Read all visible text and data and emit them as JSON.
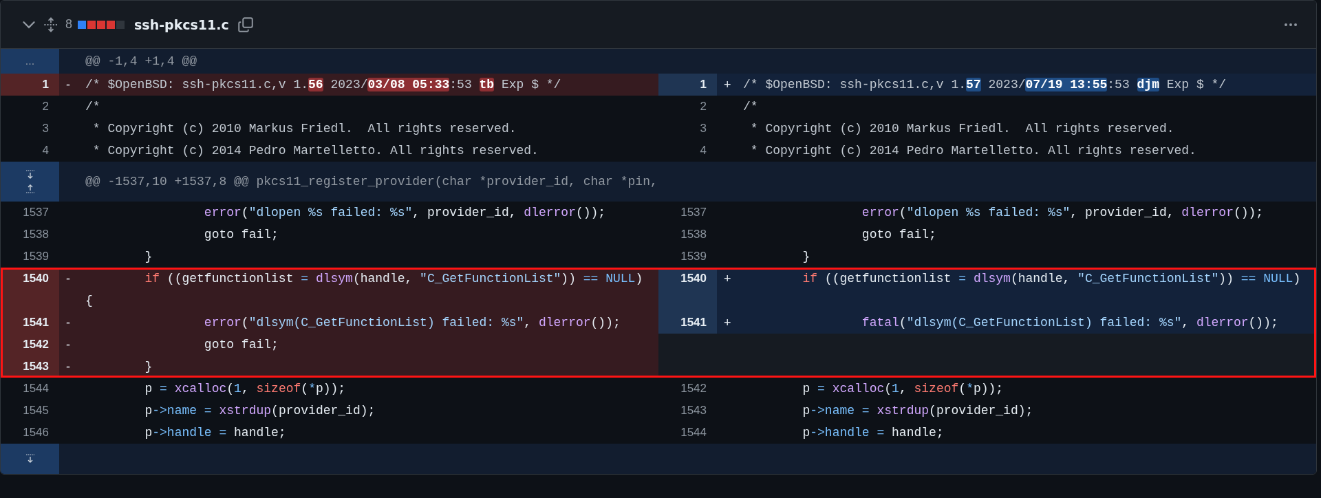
{
  "file": {
    "name": "ssh-pkcs11.c",
    "changes": "8",
    "diffstat": [
      {
        "kind": "added"
      },
      {
        "kind": "deleted"
      },
      {
        "kind": "deleted"
      },
      {
        "kind": "deleted"
      },
      {
        "kind": "neutral"
      }
    ]
  },
  "hunks": [
    {
      "kind": "ellipsis",
      "expander_text": "...",
      "header": "@@ -1,4 +1,4 @@",
      "blocks": [
        {
          "highlighted": false,
          "rows": [
            {
              "left": {
                "kind": "deleted",
                "num": "1",
                "sign": "-",
                "tokens": [
                  {
                    "text": "/* $OpenBSD: ssh-pkcs11.c,v 1.",
                    "kind": "comment"
                  },
                  {
                    "text": "56",
                    "kind": "changed"
                  },
                  {
                    "text": " 2023/",
                    "kind": "comment"
                  },
                  {
                    "text": "03/08 05:33",
                    "kind": "changed"
                  },
                  {
                    "text": ":53 ",
                    "kind": "comment"
                  },
                  {
                    "text": "tb",
                    "kind": "changed"
                  },
                  {
                    "text": " Exp $ */",
                    "kind": "comment"
                  }
                ]
              },
              "right": {
                "kind": "added",
                "num": "1",
                "sign": "+",
                "tokens": [
                  {
                    "text": "/* $OpenBSD: ssh-pkcs11.c,v 1.",
                    "kind": "comment"
                  },
                  {
                    "text": "57",
                    "kind": "changed"
                  },
                  {
                    "text": " 2023/",
                    "kind": "comment"
                  },
                  {
                    "text": "07/19 13:55",
                    "kind": "changed"
                  },
                  {
                    "text": ":53 ",
                    "kind": "comment"
                  },
                  {
                    "text": "djm",
                    "kind": "changed"
                  },
                  {
                    "text": " Exp $ */",
                    "kind": "comment"
                  }
                ]
              }
            },
            {
              "left": {
                "kind": "context",
                "num": "2",
                "tokens": [
                  {
                    "text": "/*",
                    "kind": "comment"
                  }
                ]
              },
              "right": {
                "kind": "context",
                "num": "2",
                "tokens": [
                  {
                    "text": "/*",
                    "kind": "comment"
                  }
                ]
              }
            },
            {
              "left": {
                "kind": "context",
                "num": "3",
                "tokens": [
                  {
                    "text": " * Copyright (c) 2010 Markus Friedl.  All rights reserved.",
                    "kind": "comment"
                  }
                ]
              },
              "right": {
                "kind": "context",
                "num": "3",
                "tokens": [
                  {
                    "text": " * Copyright (c) 2010 Markus Friedl.  All rights reserved.",
                    "kind": "comment"
                  }
                ]
              }
            },
            {
              "left": {
                "kind": "context",
                "num": "4",
                "tokens": [
                  {
                    "text": " * Copyright (c) 2014 Pedro Martelletto. All rights reserved.",
                    "kind": "comment"
                  }
                ]
              },
              "right": {
                "kind": "context",
                "num": "4",
                "tokens": [
                  {
                    "text": " * Copyright (c) 2014 Pedro Martelletto. All rights reserved.",
                    "kind": "comment"
                  }
                ]
              }
            }
          ]
        }
      ]
    },
    {
      "kind": "both",
      "header": "@@ -1537,10 +1537,8 @@ pkcs11_register_provider(char *provider_id, char *pin,",
      "blocks": [
        {
          "highlighted": false,
          "rows": [
            {
              "left": {
                "kind": "context",
                "num": "1537",
                "tokens": [
                  {
                    "text": "\t\terror",
                    "kind": "func"
                  },
                  {
                    "text": "(",
                    "kind": "plain"
                  },
                  {
                    "text": "\"dlopen %s failed: %s\"",
                    "kind": "string"
                  },
                  {
                    "text": ", provider_id, ",
                    "kind": "plain"
                  },
                  {
                    "text": "dlerror",
                    "kind": "func"
                  },
                  {
                    "text": "());",
                    "kind": "plain"
                  }
                ]
              },
              "right": {
                "kind": "context",
                "num": "1537",
                "tokens": [
                  {
                    "text": "\t\terror",
                    "kind": "func"
                  },
                  {
                    "text": "(",
                    "kind": "plain"
                  },
                  {
                    "text": "\"dlopen %s failed: %s\"",
                    "kind": "string"
                  },
                  {
                    "text": ", provider_id, ",
                    "kind": "plain"
                  },
                  {
                    "text": "dlerror",
                    "kind": "func"
                  },
                  {
                    "text": "());",
                    "kind": "plain"
                  }
                ]
              }
            },
            {
              "left": {
                "kind": "context",
                "num": "1538",
                "tokens": [
                  {
                    "text": "\t\tgoto fail;",
                    "kind": "plain"
                  }
                ]
              },
              "right": {
                "kind": "context",
                "num": "1538",
                "tokens": [
                  {
                    "text": "\t\tgoto fail;",
                    "kind": "plain"
                  }
                ]
              }
            },
            {
              "left": {
                "kind": "context",
                "num": "1539",
                "tokens": [
                  {
                    "text": "\t}",
                    "kind": "plain"
                  }
                ]
              },
              "right": {
                "kind": "context",
                "num": "1539",
                "tokens": [
                  {
                    "text": "\t}",
                    "kind": "plain"
                  }
                ]
              }
            }
          ]
        },
        {
          "highlighted": true,
          "rows": [
            {
              "left": {
                "kind": "deleted",
                "num": "1540",
                "sign": "-",
                "tokens": [
                  {
                    "text": "\tif",
                    "kind": "keyword"
                  },
                  {
                    "text": " ((getfunctionlist",
                    "kind": "plain"
                  },
                  {
                    "text": " = ",
                    "kind": "const"
                  },
                  {
                    "text": "dlsym",
                    "kind": "func"
                  },
                  {
                    "text": "(handle, ",
                    "kind": "plain"
                  },
                  {
                    "text": "\"C_GetFunctionList\"",
                    "kind": "string"
                  },
                  {
                    "text": "))",
                    "kind": "plain"
                  },
                  {
                    "text": " == NULL",
                    "kind": "const"
                  },
                  {
                    "text": ") {",
                    "kind": "plain"
                  }
                ]
              },
              "right": {
                "kind": "added",
                "num": "1540",
                "sign": "+",
                "tokens": [
                  {
                    "text": "\tif",
                    "kind": "keyword"
                  },
                  {
                    "text": " ((getfunctionlist",
                    "kind": "plain"
                  },
                  {
                    "text": " = ",
                    "kind": "const"
                  },
                  {
                    "text": "dlsym",
                    "kind": "func"
                  },
                  {
                    "text": "(handle, ",
                    "kind": "plain"
                  },
                  {
                    "text": "\"C_GetFunctionList\"",
                    "kind": "string"
                  },
                  {
                    "text": "))",
                    "kind": "plain"
                  },
                  {
                    "text": " == NULL",
                    "kind": "const"
                  },
                  {
                    "text": ")",
                    "kind": "plain"
                  }
                ]
              }
            },
            {
              "left": {
                "kind": "deleted",
                "num": "1541",
                "sign": "-",
                "tokens": [
                  {
                    "text": "\t\terror",
                    "kind": "func"
                  },
                  {
                    "text": "(",
                    "kind": "plain"
                  },
                  {
                    "text": "\"dlsym(C_GetFunctionList) failed: %s\"",
                    "kind": "string"
                  },
                  {
                    "text": ", ",
                    "kind": "plain"
                  },
                  {
                    "text": "dlerror",
                    "kind": "func"
                  },
                  {
                    "text": "());",
                    "kind": "plain"
                  }
                ]
              },
              "right": {
                "kind": "added",
                "num": "1541",
                "sign": "+",
                "tokens": [
                  {
                    "text": "\t\tfatal",
                    "kind": "func"
                  },
                  {
                    "text": "(",
                    "kind": "plain"
                  },
                  {
                    "text": "\"dlsym(C_GetFunctionList) failed: %s\"",
                    "kind": "string"
                  },
                  {
                    "text": ", ",
                    "kind": "plain"
                  },
                  {
                    "text": "dlerror",
                    "kind": "func"
                  },
                  {
                    "text": "());",
                    "kind": "plain"
                  }
                ]
              }
            },
            {
              "left": {
                "kind": "deleted",
                "num": "1542",
                "sign": "-",
                "tokens": [
                  {
                    "text": "\t\tgoto fail;",
                    "kind": "plain"
                  }
                ]
              },
              "right": {
                "kind": "empty"
              }
            },
            {
              "left": {
                "kind": "deleted",
                "num": "1543",
                "sign": "-",
                "tokens": [
                  {
                    "text": "\t}",
                    "kind": "plain"
                  }
                ]
              },
              "right": {
                "kind": "empty"
              }
            }
          ]
        },
        {
          "highlighted": false,
          "rows": [
            {
              "left": {
                "kind": "context",
                "num": "1544",
                "tokens": [
                  {
                    "text": "\tp",
                    "kind": "plain"
                  },
                  {
                    "text": " = ",
                    "kind": "const"
                  },
                  {
                    "text": "xcalloc",
                    "kind": "func"
                  },
                  {
                    "text": "(",
                    "kind": "plain"
                  },
                  {
                    "text": "1",
                    "kind": "const"
                  },
                  {
                    "text": ", ",
                    "kind": "plain"
                  },
                  {
                    "text": "sizeof",
                    "kind": "keyword"
                  },
                  {
                    "text": "(",
                    "kind": "plain"
                  },
                  {
                    "text": "*",
                    "kind": "const"
                  },
                  {
                    "text": "p));",
                    "kind": "plain"
                  }
                ]
              },
              "right": {
                "kind": "context",
                "num": "1542",
                "tokens": [
                  {
                    "text": "\tp",
                    "kind": "plain"
                  },
                  {
                    "text": " = ",
                    "kind": "const"
                  },
                  {
                    "text": "xcalloc",
                    "kind": "func"
                  },
                  {
                    "text": "(",
                    "kind": "plain"
                  },
                  {
                    "text": "1",
                    "kind": "const"
                  },
                  {
                    "text": ", ",
                    "kind": "plain"
                  },
                  {
                    "text": "sizeof",
                    "kind": "keyword"
                  },
                  {
                    "text": "(",
                    "kind": "plain"
                  },
                  {
                    "text": "*",
                    "kind": "const"
                  },
                  {
                    "text": "p));",
                    "kind": "plain"
                  }
                ]
              }
            },
            {
              "left": {
                "kind": "context",
                "num": "1545",
                "tokens": [
                  {
                    "text": "\tp",
                    "kind": "plain"
                  },
                  {
                    "text": "->name = ",
                    "kind": "const"
                  },
                  {
                    "text": "xstrdup",
                    "kind": "func"
                  },
                  {
                    "text": "(provider_id);",
                    "kind": "plain"
                  }
                ]
              },
              "right": {
                "kind": "context",
                "num": "1543",
                "tokens": [
                  {
                    "text": "\tp",
                    "kind": "plain"
                  },
                  {
                    "text": "->name = ",
                    "kind": "const"
                  },
                  {
                    "text": "xstrdup",
                    "kind": "func"
                  },
                  {
                    "text": "(provider_id);",
                    "kind": "plain"
                  }
                ]
              }
            },
            {
              "left": {
                "kind": "context",
                "num": "1546",
                "tokens": [
                  {
                    "text": "\tp",
                    "kind": "plain"
                  },
                  {
                    "text": "->handle = ",
                    "kind": "const"
                  },
                  {
                    "text": "handle;",
                    "kind": "plain"
                  }
                ]
              },
              "right": {
                "kind": "context",
                "num": "1544",
                "tokens": [
                  {
                    "text": "\tp",
                    "kind": "plain"
                  },
                  {
                    "text": "->handle = ",
                    "kind": "const"
                  },
                  {
                    "text": "handle;",
                    "kind": "plain"
                  }
                ]
              }
            }
          ]
        }
      ]
    },
    {
      "kind": "down"
    }
  ]
}
